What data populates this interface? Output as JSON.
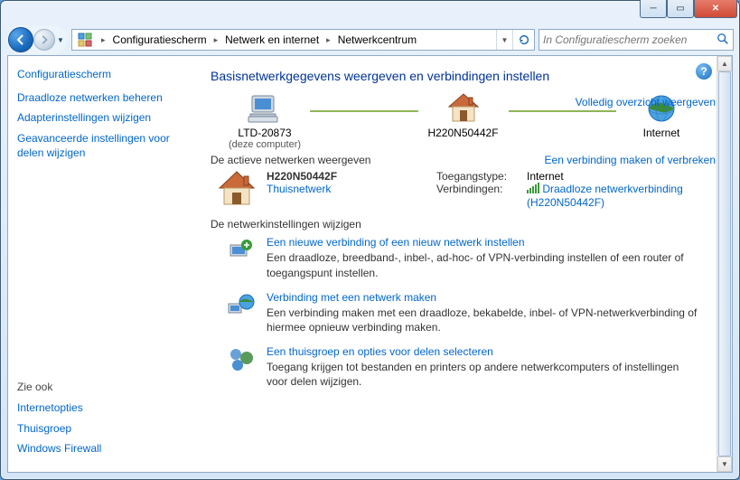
{
  "breadcrumb": {
    "items": [
      "Configuratiescherm",
      "Netwerk en internet",
      "Netwerkcentrum"
    ]
  },
  "search": {
    "placeholder": "In Configuratiescherm zoeken"
  },
  "sidebar": {
    "home": "Configuratiescherm",
    "links": [
      "Draadloze netwerken beheren",
      "Adapterinstellingen wijzigen",
      "Geavanceerde instellingen voor delen wijzigen"
    ],
    "see_also_label": "Zie ook",
    "see_also": [
      "Internetopties",
      "Thuisgroep",
      "Windows Firewall"
    ]
  },
  "page": {
    "title": "Basisnetwerkgegevens weergeven en verbindingen instellen",
    "full_map_link": "Volledig overzicht weergeven",
    "map": {
      "node1": {
        "label": "LTD-20873",
        "sub": "(deze computer)"
      },
      "node2": {
        "label": "H220N50442F"
      },
      "node3": {
        "label": "Internet"
      }
    },
    "active_strip": {
      "left": "De actieve netwerken weergeven",
      "right": "Een verbinding maken of verbreken"
    },
    "active": {
      "name": "H220N50442F",
      "type_link": "Thuisnetwerk",
      "access_label": "Toegangstype:",
      "access_value": "Internet",
      "conn_label": "Verbindingen:",
      "conn_link": "Draadloze netwerkverbinding (H220N50442F)"
    },
    "settings_head": "De netwerkinstellingen wijzigen",
    "settings": [
      {
        "title": "Een nieuwe verbinding of een nieuw netwerk instellen",
        "desc": "Een draadloze, breedband-, inbel-, ad-hoc- of VPN-verbinding instellen of een router of toegangspunt instellen."
      },
      {
        "title": "Verbinding met een netwerk maken",
        "desc": "Een verbinding maken met een draadloze, bekabelde, inbel- of VPN-netwerkverbinding of hiermee opnieuw verbinding maken."
      },
      {
        "title": "Een thuisgroep en opties voor delen selecteren",
        "desc": "Toegang krijgen tot bestanden en printers op andere netwerkcomputers of instellingen voor delen wijzigen."
      }
    ]
  }
}
